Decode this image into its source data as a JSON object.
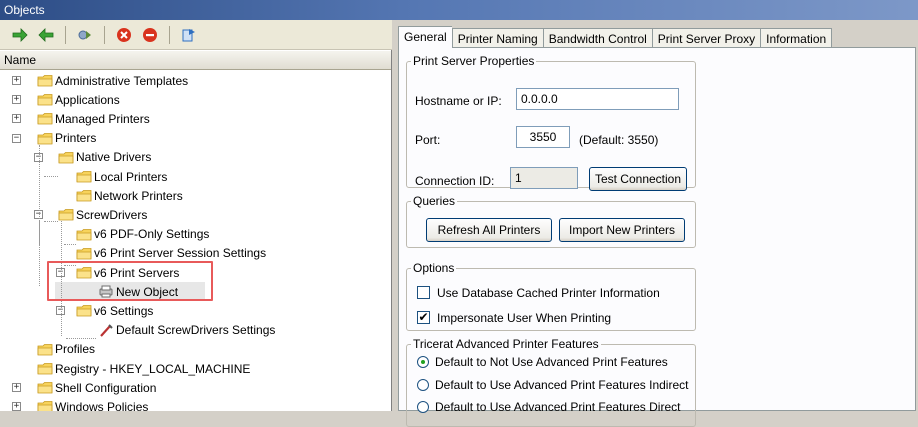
{
  "window": {
    "title": "Objects"
  },
  "toolbar": {
    "buttons": [
      {
        "name": "forward-arrow-icon",
        "color": "#3aa335"
      },
      {
        "name": "back-arrow-icon",
        "color": "#3aa335"
      },
      {
        "name": "refresh-icon",
        "color": "#5b8a3a"
      },
      {
        "name": "delete-icon",
        "color": "#d9331e"
      },
      {
        "name": "remove-icon",
        "color": "#d9331e"
      },
      {
        "name": "properties-icon",
        "color": "#2f6fc0"
      }
    ]
  },
  "tree": {
    "column_header": "Name",
    "nodes": [
      {
        "label": "Administrative Templates",
        "expander": "+"
      },
      {
        "label": "Applications",
        "expander": "+"
      },
      {
        "label": "Managed Printers",
        "expander": "+"
      },
      {
        "label": "Printers",
        "expander": "−"
      },
      {
        "label": "Native Drivers",
        "expander": "−"
      },
      {
        "label": "Local Printers",
        "expander": ""
      },
      {
        "label": "Network Printers",
        "expander": ""
      },
      {
        "label": "ScrewDrivers",
        "expander": "−"
      },
      {
        "label": "v6 PDF-Only Settings",
        "expander": ""
      },
      {
        "label": "v6 Print Server Session Settings",
        "expander": ""
      },
      {
        "label": "v6 Print Servers",
        "expander": "−"
      },
      {
        "label": "New Object",
        "expander": ""
      },
      {
        "label": "v6 Settings",
        "expander": "−"
      },
      {
        "label": "Default ScrewDrivers Settings",
        "expander": ""
      },
      {
        "label": "Profiles",
        "expander": ""
      },
      {
        "label": "Registry - HKEY_LOCAL_MACHINE",
        "expander": ""
      },
      {
        "label": "Shell Configuration",
        "expander": "+"
      },
      {
        "label": "Windows Policies",
        "expander": "+"
      }
    ],
    "highlight_color": "#e85a5a"
  },
  "tabs": [
    "General",
    "Printer Naming",
    "Bandwidth Control",
    "Print Server Proxy",
    "Information"
  ],
  "print_server": {
    "legend": "Print Server Properties",
    "hostname_label": "Hostname or IP:",
    "hostname_value": "0.0.0.0",
    "port_label": "Port:",
    "port_value": "3550",
    "port_default": "(Default: 3550)",
    "connection_label": "Connection ID:",
    "connection_value": "1",
    "test_button": "Test Connection"
  },
  "queries": {
    "legend": "Queries",
    "refresh_button": "Refresh All Printers",
    "import_button": "Import New Printers"
  },
  "options": {
    "legend": "Options",
    "cached_label": "Use Database Cached Printer Information",
    "cached_checked": false,
    "impersonate_label": "Impersonate User When Printing",
    "impersonate_checked": true
  },
  "advanced": {
    "legend": "Tricerat Advanced Printer Features",
    "radios": [
      {
        "label": "Default to Not Use Advanced Print Features",
        "selected": true
      },
      {
        "label": "Default to Use Advanced Print Features Indirect",
        "selected": false
      },
      {
        "label": "Default to Use Advanced Print Features Direct",
        "selected": false
      }
    ]
  }
}
